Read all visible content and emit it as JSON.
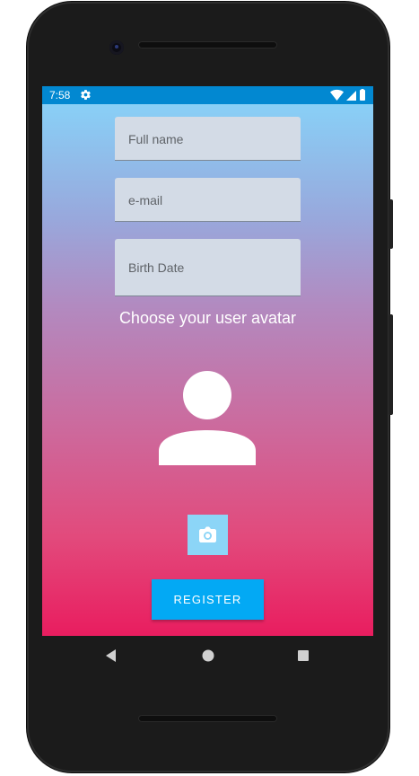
{
  "device": {
    "frame_color": "#1b1b1b"
  },
  "status_bar": {
    "time": "7:58",
    "left_icon": "gear-icon",
    "right_icons": [
      "wifi-icon",
      "signal-icon",
      "battery-icon"
    ],
    "background": "#0288d1"
  },
  "form": {
    "full_name": {
      "placeholder": "Full name"
    },
    "email": {
      "placeholder": "e-mail"
    },
    "birth_date": {
      "placeholder": "Birth Date"
    }
  },
  "avatar": {
    "label": "Choose your user avatar",
    "icon": "user-avatar-icon",
    "camera_icon": "camera-icon"
  },
  "actions": {
    "register_label": "REGISTER",
    "register_color": "#03a9f4"
  },
  "gradient": {
    "top": "#86d6fb",
    "bottom": "#e91d5f"
  },
  "nav_bar": {
    "buttons": [
      "back-icon",
      "home-icon",
      "recents-icon"
    ]
  }
}
